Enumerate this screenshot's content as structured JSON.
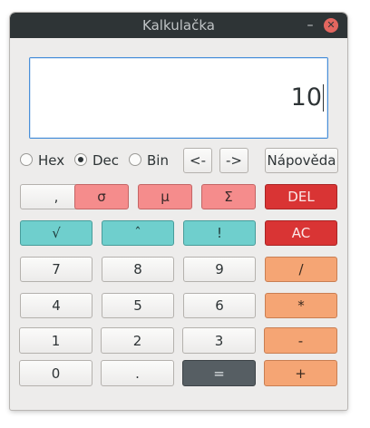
{
  "window": {
    "title": "Kalkulačka",
    "minimize_label": "–",
    "close_label": "✕"
  },
  "display": {
    "value": "10"
  },
  "modes": [
    {
      "label": "Hex",
      "selected": false
    },
    {
      "label": "Dec",
      "selected": true
    },
    {
      "label": "Bin",
      "selected": false
    }
  ],
  "nav": {
    "left": "<-",
    "right": "->",
    "help": "Nápověda"
  },
  "keys": {
    "comma": ",",
    "sigma": "σ",
    "mu": "μ",
    "sum": "Σ",
    "del": "DEL",
    "sqrt": "√",
    "power": "ˆ",
    "factorial": "!",
    "ac": "AC",
    "seven": "7",
    "eight": "8",
    "nine": "9",
    "divide": "/",
    "four": "4",
    "five": "5",
    "six": "6",
    "multiply": "*",
    "one": "1",
    "two": "2",
    "three": "3",
    "minus": "-",
    "zero": "0",
    "dot": ".",
    "equals": "=",
    "plus": "+"
  }
}
